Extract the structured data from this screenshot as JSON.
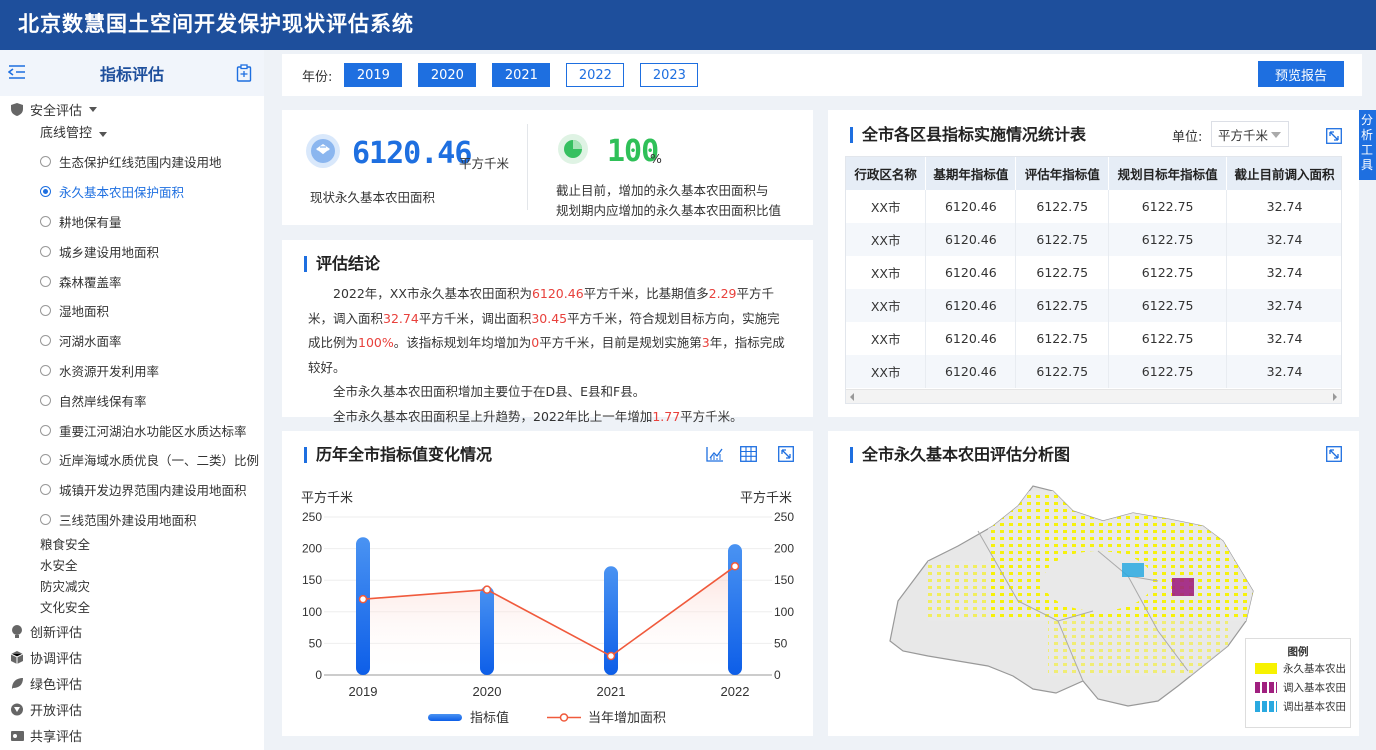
{
  "app_title": "北京数慧国土空间开发保护现状评估系统",
  "sidebar": {
    "title": "指标评估",
    "groups": [
      {
        "label": "安全评估"
      },
      {
        "label": "创新评估"
      },
      {
        "label": "协调评估"
      },
      {
        "label": "绿色评估"
      },
      {
        "label": "开放评估"
      },
      {
        "label": "共享评估"
      }
    ],
    "subgroup": "底线管控",
    "items": [
      "生态保护红线范围内建设用地",
      "永久基本农田保护面积",
      "耕地保有量",
      "城乡建设用地面积",
      "森林覆盖率",
      "湿地面积",
      "河湖水面率",
      "水资源开发利用率",
      "自然岸线保有率",
      "重要江河湖泊水功能区水质达标率",
      "近岸海域水质优良（一、二类）比例",
      "城镇开发边界范围内建设用地面积",
      "三线范围外建设用地面积"
    ],
    "selected_index": 1,
    "other_subgroups": [
      "粮食安全",
      "水安全",
      "防灾减灾",
      "文化安全"
    ]
  },
  "topbar": {
    "year_label": "年份:",
    "years": [
      "2019",
      "2020",
      "2021",
      "2022",
      "2023"
    ],
    "active_years": [
      "2019",
      "2020",
      "2021"
    ],
    "preview_button": "预览报告"
  },
  "stats": {
    "area_value": "6120.46",
    "area_unit": "平方千米",
    "area_caption": "现状永久基本农田面积",
    "ratio_value": "100",
    "ratio_unit": "%",
    "ratio_caption_1": "截止目前，增加的永久基本农田面积与",
    "ratio_caption_2": "规划期内应增加的永久基本农田面积比值"
  },
  "conclusion": {
    "title": "评估结论",
    "p1": [
      {
        "t": "2022年，XX市永久基本农田面积为",
        "hl": false
      },
      {
        "t": "6120.46",
        "hl": true
      },
      {
        "t": "平方千米，比基期值多",
        "hl": false
      },
      {
        "t": "2.29",
        "hl": true
      },
      {
        "t": "平方千米，调入面积",
        "hl": false
      },
      {
        "t": "32.74",
        "hl": true
      },
      {
        "t": "平方千米，调出面积",
        "hl": false
      },
      {
        "t": "30.45",
        "hl": true
      },
      {
        "t": "平方千米，符合规划目标方向，实施完成比例为",
        "hl": false
      },
      {
        "t": "100%",
        "hl": true
      },
      {
        "t": "。该指标规划年均增加为",
        "hl": false
      },
      {
        "t": "0",
        "hl": true
      },
      {
        "t": "平方千米，目前是规划实施第",
        "hl": false
      },
      {
        "t": "3",
        "hl": true
      },
      {
        "t": "年，指标完成较好。",
        "hl": false
      }
    ],
    "p2": "全市永久基本农田面积增加主要位于在D县、E县和F县。",
    "p3": [
      {
        "t": "全市永久基本农田面积呈上升趋势，2022年比上一年增加",
        "hl": false
      },
      {
        "t": "1.77",
        "hl": true
      },
      {
        "t": "平方千米。",
        "hl": false
      }
    ]
  },
  "table": {
    "title": "全市各区县指标实施情况统计表",
    "unit_label": "单位:",
    "unit_value": "平方千米",
    "headers": [
      "行政区名称",
      "基期年指标值",
      "评估年指标值",
      "规划目标年指标值",
      "截止目前调入面积"
    ],
    "rows": [
      [
        "XX市",
        "6120.46",
        "6122.75",
        "6122.75",
        "32.74"
      ],
      [
        "XX市",
        "6120.46",
        "6122.75",
        "6122.75",
        "32.74"
      ],
      [
        "XX市",
        "6120.46",
        "6122.75",
        "6122.75",
        "32.74"
      ],
      [
        "XX市",
        "6120.46",
        "6122.75",
        "6122.75",
        "32.74"
      ],
      [
        "XX市",
        "6120.46",
        "6122.75",
        "6122.75",
        "32.74"
      ],
      [
        "XX市",
        "6120.46",
        "6122.75",
        "6122.75",
        "32.74"
      ]
    ]
  },
  "side_tool": "分析工具",
  "chart_data": {
    "type": "bar",
    "title": "历年全市指标值变化情况",
    "categories": [
      "2019",
      "2020",
      "2021",
      "2022"
    ],
    "ylabel_left": "平方千米",
    "ylabel_right": "平方千米",
    "ylim": [
      0,
      250
    ],
    "yticks": [
      0,
      50,
      100,
      150,
      200,
      250
    ],
    "series": [
      {
        "name": "指标值",
        "type": "bar",
        "values": [
          218,
          140,
          172,
          207
        ]
      },
      {
        "name": "当年增加面积",
        "type": "line",
        "values": [
          120,
          135,
          30,
          172
        ]
      }
    ],
    "colors": {
      "bar": "#1e6fe0",
      "line": "#f05a3c"
    }
  },
  "map": {
    "title": "全市永久基本农田评估分析图",
    "legend_title": "图例",
    "legend": [
      {
        "label": "永久基本农出",
        "color": "#f7f200"
      },
      {
        "label": "调入基本农田",
        "color": "#a0207f"
      },
      {
        "label": "调出基本农田",
        "color": "#2aa9e0"
      }
    ]
  }
}
